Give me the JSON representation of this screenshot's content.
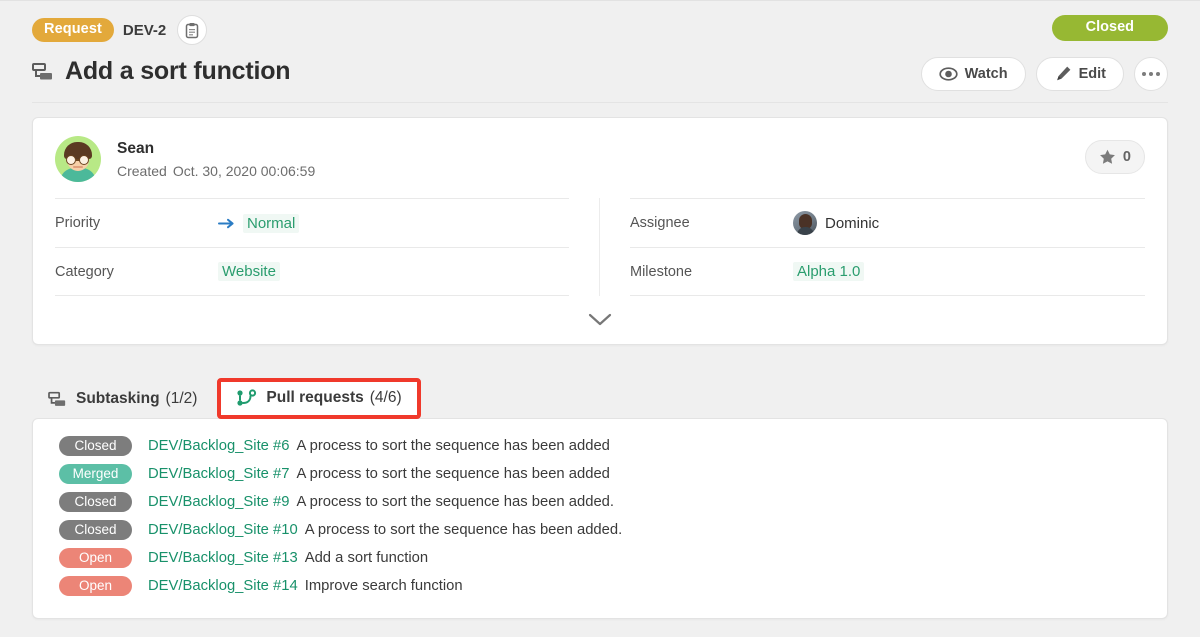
{
  "header": {
    "type_badge": "Request",
    "issue_key": "DEV-2",
    "copy_icon": "clipboard-icon",
    "title": "Add a sort function",
    "title_icon": "subtask-icon",
    "status": "Closed",
    "status_color": "#97b833",
    "badge_color": "#e3a93b",
    "actions": [
      {
        "label": "Watch",
        "icon": "eye-icon"
      },
      {
        "label": "Edit",
        "icon": "pen-icon"
      }
    ],
    "more_icon": "ellipsis-icon"
  },
  "detail": {
    "creator_name": "Sean",
    "created_label": "Created",
    "created_date": "Oct. 30, 2020 00:06:59",
    "avatar_icon": "user-avatar-sean",
    "star_icon": "star-icon",
    "star_count": "0",
    "expand_icon": "chevron-down-icon",
    "left_props": [
      {
        "label": "Priority",
        "value": "Normal",
        "icon": "arrow-right-icon",
        "link": true
      },
      {
        "label": "Category",
        "value": "Website",
        "icon": "",
        "link": true
      }
    ],
    "right_props": [
      {
        "label": "Assignee",
        "value": "Dominic",
        "icon": "user-avatar-dominic",
        "link": false
      },
      {
        "label": "Milestone",
        "value": "Alpha 1.0",
        "icon": "",
        "link": true
      }
    ]
  },
  "tabs": [
    {
      "label": "Subtasking",
      "count": "(1/2)",
      "icon": "subtask-icon",
      "active": false
    },
    {
      "label": "Pull requests",
      "count": "(4/6)",
      "icon": "pull-request-icon",
      "active": true
    }
  ],
  "highlight_color": "#f0392b",
  "pull_requests": [
    {
      "status": "Closed",
      "status_class": "st-closed",
      "repo": "DEV/Backlog_Site #6",
      "title": "A process to sort the sequence has been added"
    },
    {
      "status": "Merged",
      "status_class": "st-merged",
      "repo": "DEV/Backlog_Site #7",
      "title": "A process to sort the sequence has been added"
    },
    {
      "status": "Closed",
      "status_class": "st-closed",
      "repo": "DEV/Backlog_Site #9",
      "title": "A process to sort the sequence has been added."
    },
    {
      "status": "Closed",
      "status_class": "st-closed",
      "repo": "DEV/Backlog_Site #10",
      "title": "A process to sort the sequence has been added."
    },
    {
      "status": "Open",
      "status_class": "st-open",
      "repo": "DEV/Backlog_Site #13",
      "title": "Add a sort function"
    },
    {
      "status": "Open",
      "status_class": "st-open",
      "repo": "DEV/Backlog_Site #14",
      "title": "Improve search function"
    }
  ]
}
